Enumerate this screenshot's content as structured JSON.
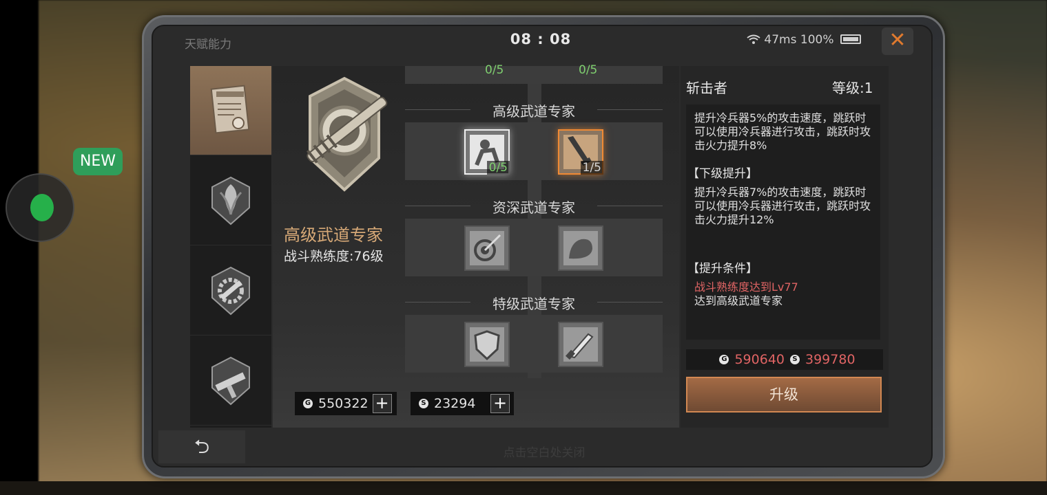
{
  "overlay": {
    "new_badge": "NEW"
  },
  "window": {
    "title": "天赋能力",
    "clock": "08 : 08",
    "ping": "47ms",
    "battery": "100%",
    "close_glyph": "✕"
  },
  "tabs": [
    {
      "icon": "certificate-icon",
      "active": true
    },
    {
      "icon": "leaf-emblem-icon",
      "active": false
    },
    {
      "icon": "gear-hammer-icon",
      "active": false
    },
    {
      "icon": "smg-icon",
      "active": false
    }
  ],
  "rank": {
    "title": "高级武道专家",
    "level_text": "战斗熟练度:76级"
  },
  "tree": {
    "top_row": {
      "counts": [
        "0/5",
        "0/5"
      ]
    },
    "tiers": [
      {
        "name": "高级武道专家",
        "skills": [
          {
            "icon": "grapple-icon",
            "count": "0/5"
          },
          {
            "icon": "blade-slash-icon",
            "count": "1/5"
          }
        ]
      },
      {
        "name": "资深武道专家",
        "skills": [
          {
            "icon": "target-dart-icon"
          },
          {
            "icon": "fist-icon"
          }
        ]
      },
      {
        "name": "特级武道专家",
        "skills": [
          {
            "icon": "shield-icon"
          },
          {
            "icon": "knife-icon"
          }
        ]
      }
    ]
  },
  "wallet": {
    "coins": "550322",
    "silver": "23294",
    "plus": "+"
  },
  "detail": {
    "name": "斩击者",
    "level": "等级:1",
    "current_desc": "提升冷兵器5%的攻击速度，跳跃时可以使用冷兵器进行攻击，跳跃时攻击火力提升8%",
    "next_header": "【下级提升】",
    "next_desc": "提升冷兵器7%的攻击速度，跳跃时可以使用冷兵器进行攻击，跳跃时攻击火力提升12%",
    "cond_header": "【提升条件】",
    "cond_unmet": "战斗熟练度达到Lv77",
    "cond_met": "达到高级武道专家",
    "cost_coins": "590640",
    "cost_silver": "399780",
    "upgrade_label": "升级"
  },
  "footer": {
    "back_glyph": "⮌",
    "hint": "点击空白处关闭"
  },
  "colors": {
    "accent": "#d7a977",
    "red": "#e06464",
    "green": "#7fcf6f",
    "orange": "#f08a34"
  }
}
